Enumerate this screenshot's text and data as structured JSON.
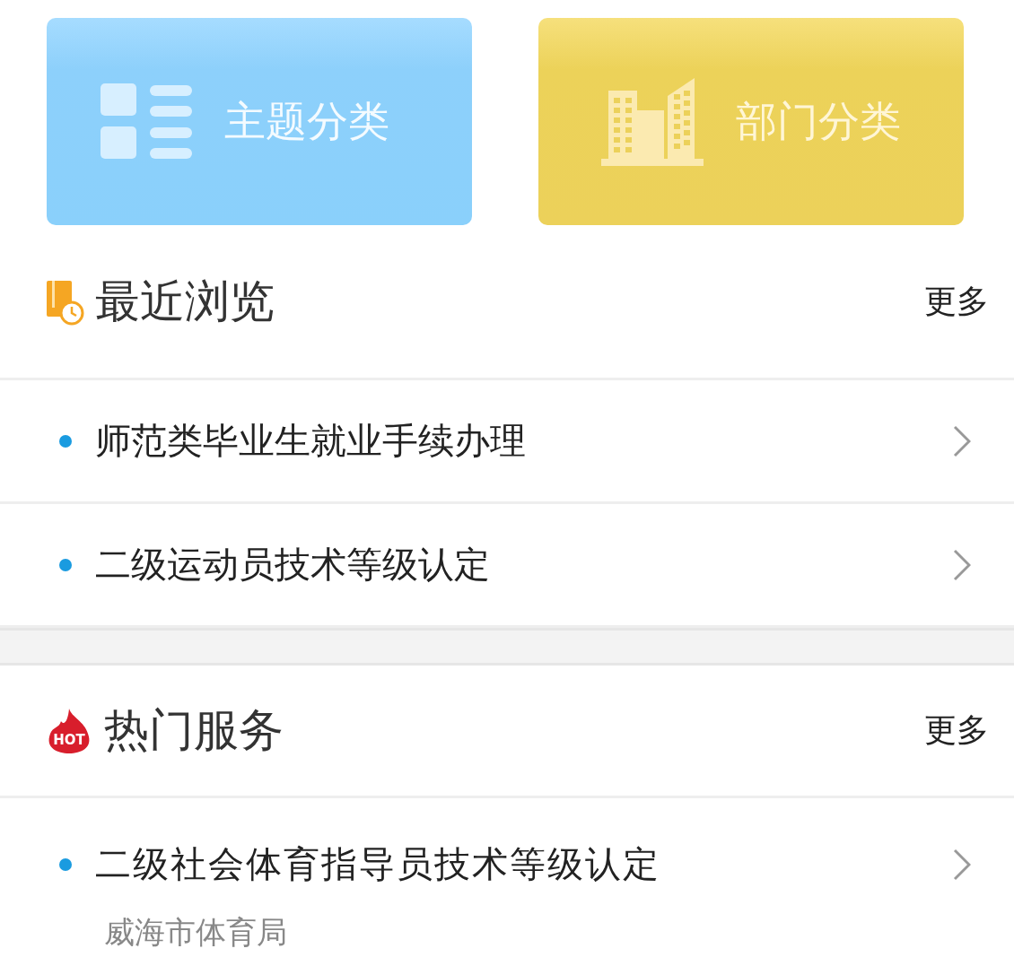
{
  "categories": [
    {
      "kind": "topic",
      "label": "主题分类"
    },
    {
      "kind": "department",
      "label": "部门分类"
    }
  ],
  "sections": [
    {
      "kind": "recent",
      "title": "最近浏览",
      "more": "更多",
      "items": [
        {
          "title": "师范类毕业生就业手续办理"
        },
        {
          "title": "二级运动员技术等级认定"
        }
      ]
    },
    {
      "kind": "hot",
      "badge": "HOT",
      "title": "热门服务",
      "more": "更多",
      "items": [
        {
          "title": "二级社会体育指导员技术等级认定",
          "subtitle": "威海市体育局"
        }
      ]
    }
  ]
}
